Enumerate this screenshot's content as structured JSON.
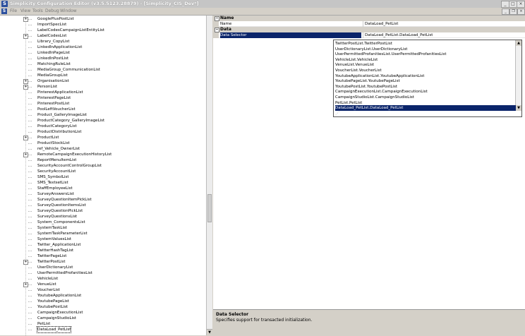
{
  "window": {
    "title": "Simplicity Configuration Editor (v3.5.5123.28879) - [Simplicity_CIS_Dev*]",
    "app_icon_glyph": "S",
    "controls": [
      "_",
      "□",
      "×"
    ]
  },
  "menu": {
    "items": [
      "File",
      "View",
      "Tools",
      "Debug",
      "Window"
    ],
    "mdi_controls": [
      "_",
      "❐",
      "×"
    ]
  },
  "tree": {
    "items": [
      {
        "label": "GooglePlusPostList",
        "expandable": true
      },
      {
        "label": "ImportSpecList",
        "expandable": false
      },
      {
        "label": "LabelCodesCampaignListEntityList",
        "expandable": false
      },
      {
        "label": "LabelCodesList",
        "expandable": true
      },
      {
        "label": "Library_CopyList",
        "expandable": false
      },
      {
        "label": "LinkedInApplicationList",
        "expandable": false
      },
      {
        "label": "LinkedInPageList",
        "expandable": false
      },
      {
        "label": "LinkedInPostList",
        "expandable": false
      },
      {
        "label": "MatchingRuleList",
        "expandable": false
      },
      {
        "label": "MediaGroup_CommunicationList",
        "expandable": false
      },
      {
        "label": "MediaGroupList",
        "expandable": false
      },
      {
        "label": "OrganisationList",
        "expandable": true
      },
      {
        "label": "PersonList",
        "expandable": true
      },
      {
        "label": "PinterestApplicationList",
        "expandable": false
      },
      {
        "label": "PinterestPageList",
        "expandable": false
      },
      {
        "label": "PinterestPostList",
        "expandable": false
      },
      {
        "label": "PoolLeftVoucherList",
        "expandable": false
      },
      {
        "label": "Product_GalleryImageList",
        "expandable": false
      },
      {
        "label": "ProductCategory_GalleryImageList",
        "expandable": false
      },
      {
        "label": "ProductCategoryList",
        "expandable": false
      },
      {
        "label": "ProductDistributionList",
        "expandable": false
      },
      {
        "label": "ProductList",
        "expandable": true
      },
      {
        "label": "ProductStockList",
        "expandable": false
      },
      {
        "label": "ref_Vehicle_OwnerList",
        "expandable": false
      },
      {
        "label": "RemoteCampaignExecutionHistoryList",
        "expandable": true
      },
      {
        "label": "ReportMenuItemList",
        "expandable": false
      },
      {
        "label": "SecurityAccountControlGroupList",
        "expandable": false
      },
      {
        "label": "SecurityAccountList",
        "expandable": false
      },
      {
        "label": "SMS_SymbolList",
        "expandable": false
      },
      {
        "label": "SMS_TextsetList",
        "expandable": false
      },
      {
        "label": "StaffEmployeeList",
        "expandable": false
      },
      {
        "label": "SurveyAnswersList",
        "expandable": false
      },
      {
        "label": "SurveyQuestionItemPickList",
        "expandable": false
      },
      {
        "label": "SurveyQuestionItemsList",
        "expandable": false
      },
      {
        "label": "SurveyQuestionPickList",
        "expandable": false
      },
      {
        "label": "SurveyQuestionsList",
        "expandable": false
      },
      {
        "label": "System_ComponentsList",
        "expandable": false
      },
      {
        "label": "SystemTaskList",
        "expandable": false
      },
      {
        "label": "SystemTaskParameterList",
        "expandable": false
      },
      {
        "label": "SystemValuesList",
        "expandable": false
      },
      {
        "label": "Twitter_ApplicationList",
        "expandable": false
      },
      {
        "label": "TwitterHashTagList",
        "expandable": false
      },
      {
        "label": "TwitterPageList",
        "expandable": false
      },
      {
        "label": "TwitterPostList",
        "expandable": true
      },
      {
        "label": "UserDictionaryList",
        "expandable": false
      },
      {
        "label": "UserPermittedProfanitiesList",
        "expandable": false
      },
      {
        "label": "VehicleList",
        "expandable": false
      },
      {
        "label": "VenueList",
        "expandable": true
      },
      {
        "label": "VoucherList",
        "expandable": false
      },
      {
        "label": "YoutubeApplicationList",
        "expandable": false
      },
      {
        "label": "YoutubePageList",
        "expandable": false
      },
      {
        "label": "YoutubePostList",
        "expandable": false
      },
      {
        "label": "CampaignExecutionList",
        "expandable": false
      },
      {
        "label": "CampaignStudioList",
        "expandable": false
      },
      {
        "label": "PetList",
        "expandable": false
      },
      {
        "label": "DataLoad_PetList",
        "expandable": false,
        "selected": true
      }
    ]
  },
  "properties": {
    "categories": [
      {
        "label": "Name",
        "items": [
          {
            "name": "Name",
            "value": "DataLoad_PetList"
          }
        ]
      },
      {
        "label": "Data",
        "items": [
          {
            "name": "Data Selector",
            "value": "DataLoad_PetList.DataLoad_PetList",
            "selected": true
          }
        ]
      }
    ]
  },
  "dropdown": {
    "options": [
      "TwitterPostList.TwitterPostList",
      "UserDictionaryList.UserDictionaryList",
      "UserPermittedProfanitiesList.UserPermittedProfanitiesList",
      "VehicleList.VehicleList",
      "VenueList.VenueList",
      "VoucherList.VoucherList",
      "YoutubeApplicationList.YoutubeApplicationList",
      "YoutubePageList.YoutubePageList",
      "YoutubePostList.YoutubePostList",
      "CampaignExecutionList.CampaignExecutionList",
      "CampaignStudioList.CampaignStudioList",
      "PetList.PetList",
      "DataLoad_PetList.DataLoad_PetList"
    ],
    "selected_index": 12
  },
  "description": {
    "title": "Data Selector",
    "text": "Specifies support for transacted initialization."
  },
  "colors": {
    "selection": "#0a246a",
    "chrome": "#d4d0c8"
  }
}
